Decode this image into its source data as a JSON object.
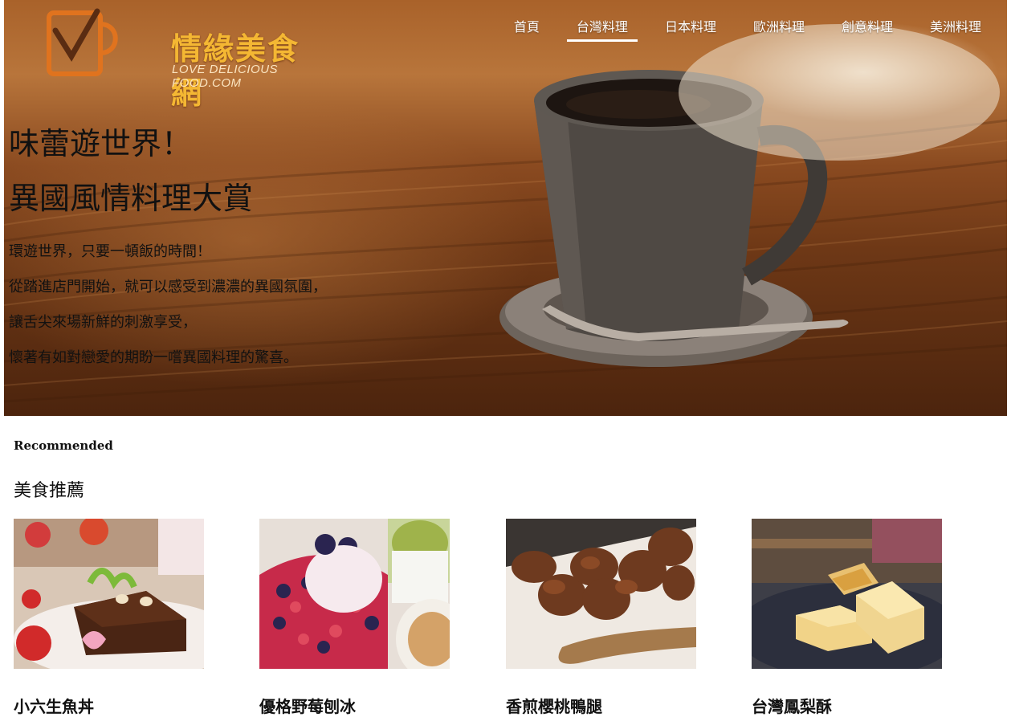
{
  "brand": {
    "title": "情緣美食網",
    "subtitle": "LOVE DELICIOUS FOOD.COM"
  },
  "nav": {
    "items": [
      {
        "label": "首頁"
      },
      {
        "label": "台灣料理"
      },
      {
        "label": "日本料理"
      },
      {
        "label": "歐洲料理"
      },
      {
        "label": "創意料理"
      },
      {
        "label": "美洲料理"
      }
    ],
    "active": "台灣料理"
  },
  "hero": {
    "title": "味蕾遊世界！",
    "subtitle": "異國風情料理大賞",
    "lines": [
      "環遊世界，只要一頓飯的時間！",
      "從踏進店門開始，就可以感受到濃濃的異國氛圍，",
      "讓舌尖來場新鮮的刺激享受，",
      "懷著有如對戀愛的期盼一嚐異國料理的驚喜。"
    ]
  },
  "recommended": {
    "label": "Recommended",
    "title": "美食推薦",
    "items": [
      {
        "name": "小六生魚丼",
        "icon": "chocolate-cake-photo"
      },
      {
        "name": "優格野莓刨冰",
        "icon": "berry-shaved-ice-photo"
      },
      {
        "name": "香煎櫻桃鴨腿",
        "icon": "duck-skewer-photo"
      },
      {
        "name": "台灣鳳梨酥",
        "icon": "pineapple-cake-photo"
      }
    ]
  }
}
